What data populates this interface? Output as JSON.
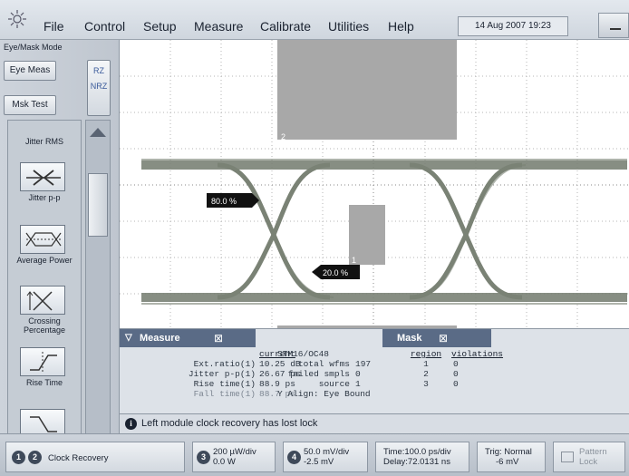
{
  "menu": {
    "items": [
      {
        "label": "File"
      },
      {
        "label": "Control"
      },
      {
        "label": "Setup"
      },
      {
        "label": "Measure"
      },
      {
        "label": "Calibrate"
      },
      {
        "label": "Utilities"
      },
      {
        "label": "Help"
      }
    ],
    "datetime": "14 Aug 2007  19:23"
  },
  "left_panel": {
    "mode_label": "Eye/Mask Mode",
    "eye_meas_label": "Eye Meas",
    "msk_test_label": "Msk Test",
    "rz_label": "RZ",
    "nrz_label": "NRZ",
    "measurements": [
      {
        "label": "Jitter RMS",
        "icon": "jitter-rms-icon"
      },
      {
        "label": "Jitter p-p",
        "icon": "jitter-pp-icon"
      },
      {
        "label": "Average Power",
        "icon": "average-power-icon"
      },
      {
        "label": "Crossing Percentage",
        "icon": "crossing-percentage-icon"
      },
      {
        "label": "Rise Time",
        "icon": "rise-time-icon"
      },
      {
        "label": "",
        "icon": "fall-time-icon"
      }
    ]
  },
  "graticule": {
    "mask_region_top": "2",
    "mask_region_center": "1",
    "marker_top": "80.0 %",
    "marker_bottom": "20.0 %"
  },
  "measure_panel": {
    "title": "Measure",
    "current_header": "current",
    "rows": [
      {
        "name": "Ext.ratio(1)",
        "value": "10.25 dB"
      },
      {
        "name": "Jitter p-p(1)",
        "value": "26.67 ps"
      },
      {
        "name": "Rise time(1)",
        "value": "88.9 ps"
      },
      {
        "name": "Fall time(1)",
        "value": "88.7 ps"
      }
    ],
    "stm_label": "STM16/OC48",
    "stats": [
      {
        "label": "total wfms",
        "value": "197"
      },
      {
        "label": "failed smpls",
        "value": "0"
      },
      {
        "label": "source",
        "value": "1"
      },
      {
        "label": "Y Align: Eye Bound",
        "value": ""
      }
    ]
  },
  "mask_panel": {
    "title": "Mask",
    "region_header": "region",
    "violations_header": "violations",
    "rows": [
      {
        "region": "1",
        "violations": "0"
      },
      {
        "region": "2",
        "violations": "0"
      },
      {
        "region": "3",
        "violations": "0"
      }
    ]
  },
  "status_line": "Left module clock recovery has lost lock",
  "bottom_bar": {
    "ch1": "1",
    "ch2": "2",
    "clock_recovery": "Clock Recovery",
    "ch3": "3",
    "scale3_line1": "200 µW/div",
    "scale3_line2": "0.0 W",
    "ch4": "4",
    "scale4_line1": "50.0 mV/div",
    "scale4_line2": "-2.5 mV",
    "time_line1": "Time:100.0 ps/div",
    "time_line2": "Delay:72.0131 ns",
    "trig_line1": "Trig: Normal",
    "trig_line2": "-6 mV",
    "pattern_line1": "Pattern",
    "pattern_line2": "Lock"
  },
  "colors": {
    "waveform": "#7a8275",
    "mask": "#a6a6a6",
    "graticule_bg": "#ffffff",
    "tab_bg": "#5a6b86"
  }
}
